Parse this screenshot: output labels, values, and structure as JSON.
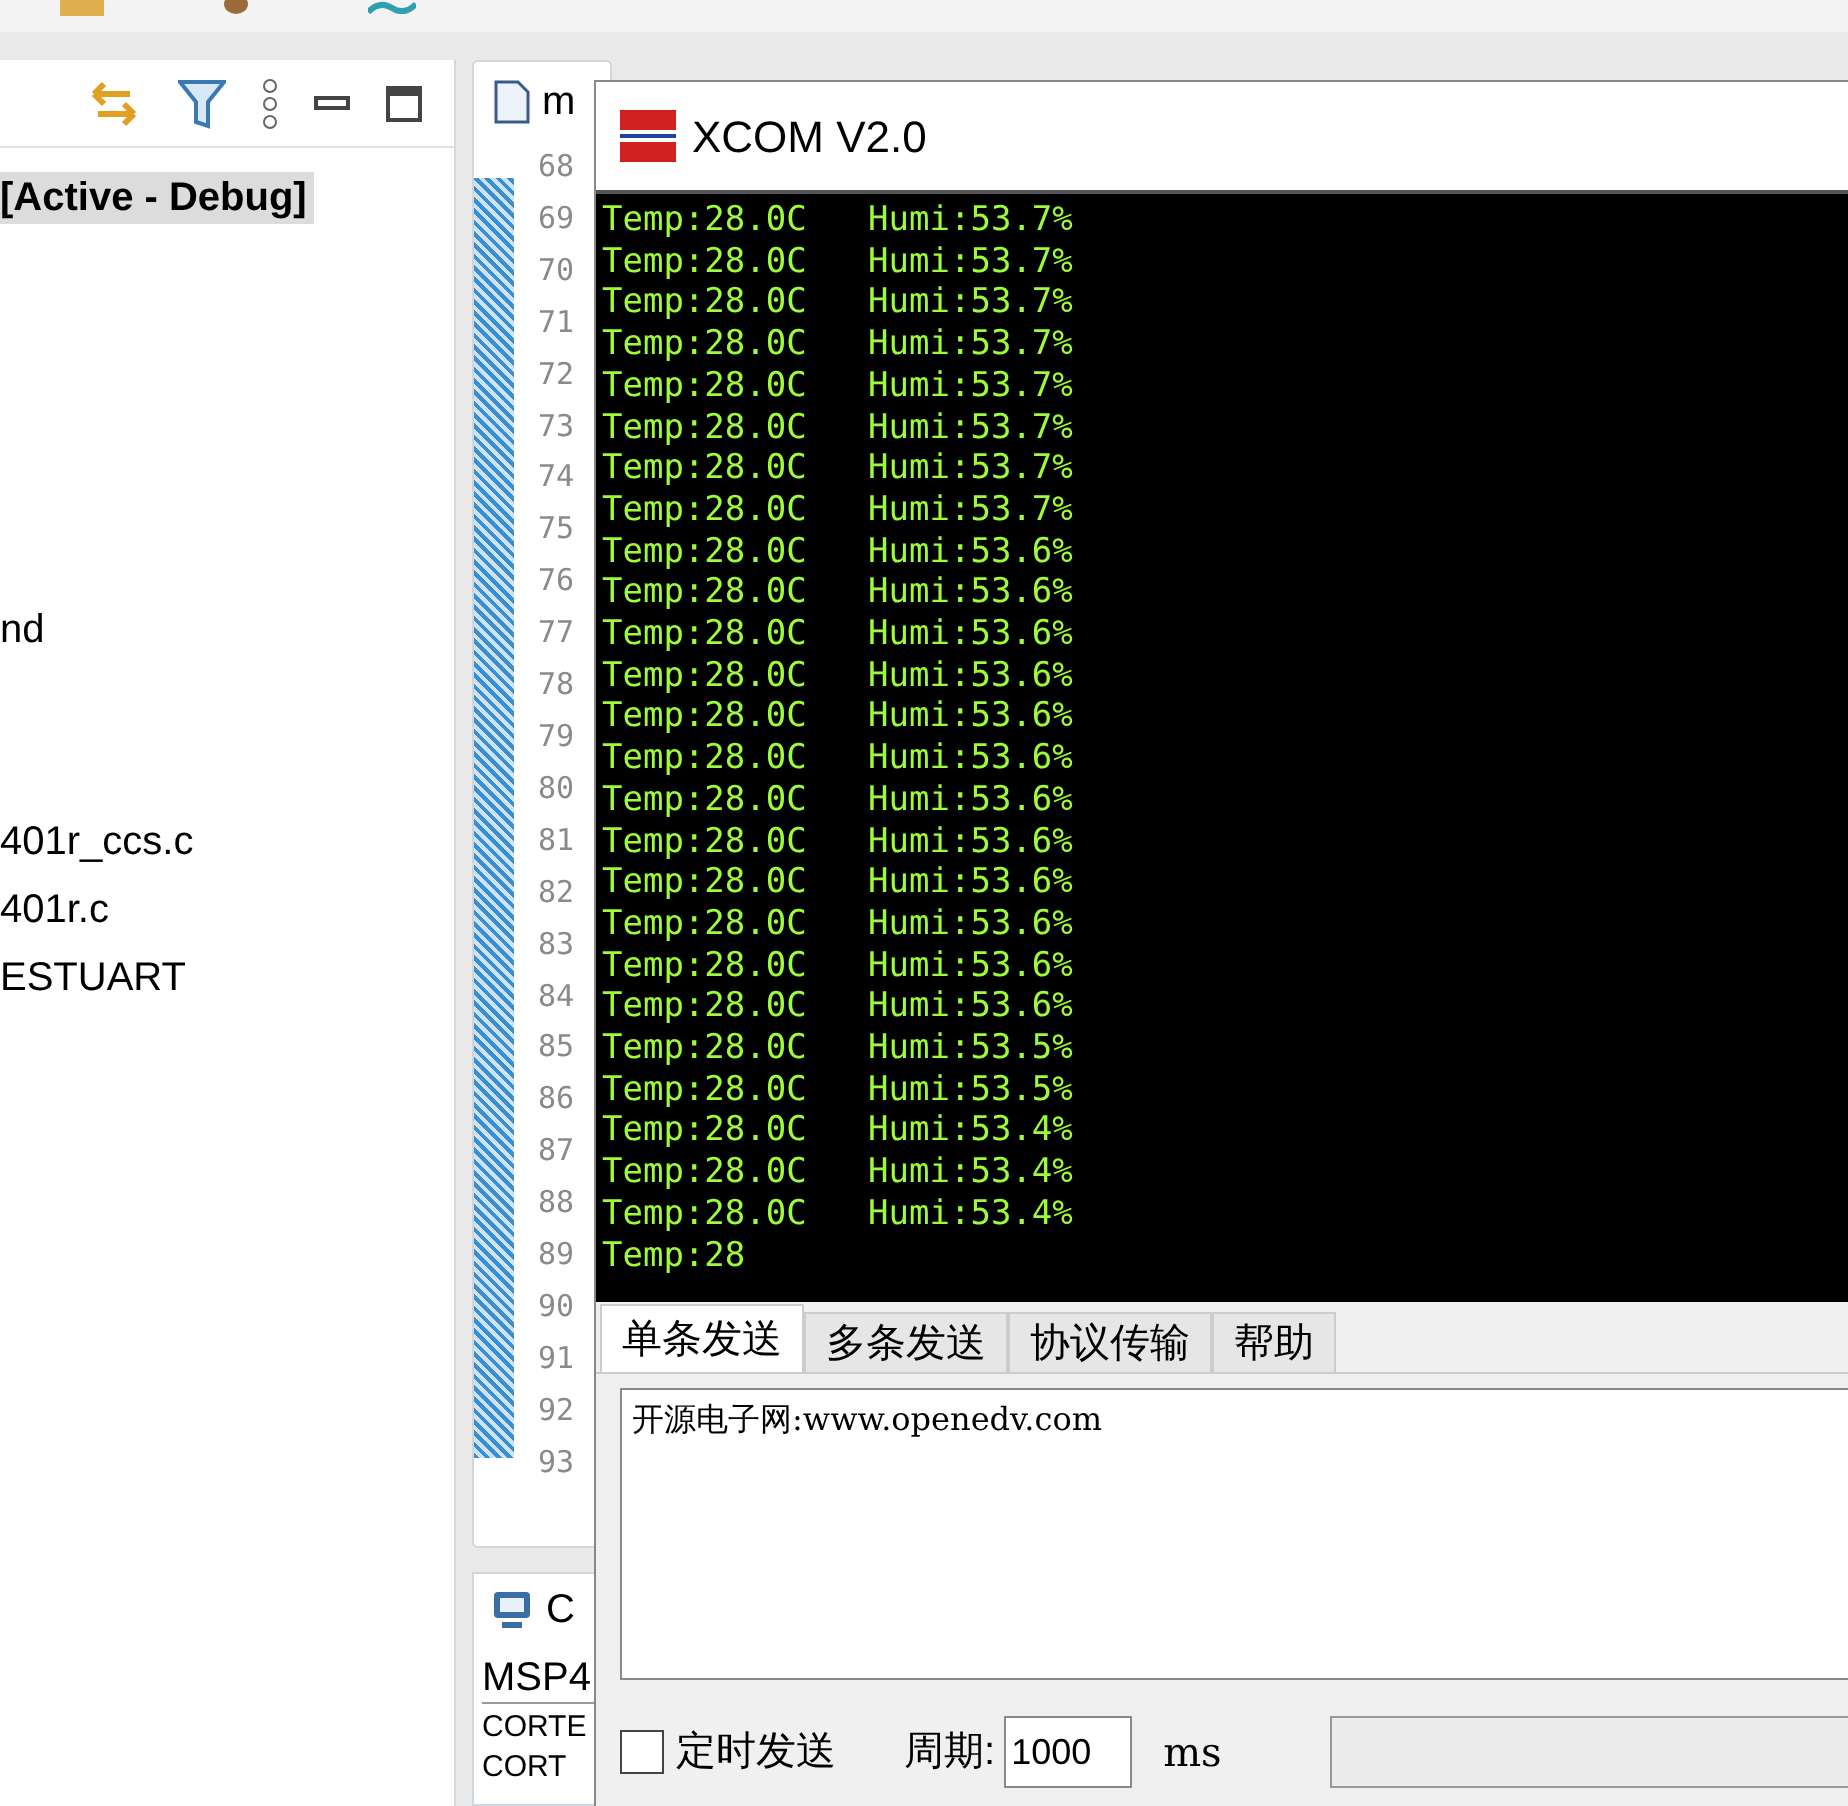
{
  "explorer": {
    "items": [
      {
        "label": "[Active - Debug]",
        "selected": true
      },
      {
        "label": "nd",
        "selected": false
      },
      {
        "label": "401r_ccs.c",
        "selected": false
      },
      {
        "label": "401r.c",
        "selected": false
      },
      {
        "label": "ESTUART",
        "selected": false
      }
    ]
  },
  "editor": {
    "tab": "m",
    "line_numbers": [
      "68",
      "69",
      "70",
      "71",
      "72",
      "73",
      "74",
      "75",
      "76",
      "77",
      "78",
      "79",
      "80",
      "81",
      "82",
      "83",
      "84",
      "85",
      "86",
      "87",
      "88",
      "89",
      "90",
      "91",
      "92",
      "93"
    ]
  },
  "console": {
    "tab": "C",
    "label": "MSP4",
    "lines": [
      "CORTE",
      "CORT"
    ]
  },
  "xcom": {
    "title": "XCOM V2.0",
    "terminal_lines": [
      "Temp:28.0C   Humi:53.7%",
      "Temp:28.0C   Humi:53.7%",
      "Temp:28.0C   Humi:53.7%",
      "Temp:28.0C   Humi:53.7%",
      "Temp:28.0C   Humi:53.7%",
      "Temp:28.0C   Humi:53.7%",
      "Temp:28.0C   Humi:53.7%",
      "Temp:28.0C   Humi:53.7%",
      "Temp:28.0C   Humi:53.6%",
      "Temp:28.0C   Humi:53.6%",
      "Temp:28.0C   Humi:53.6%",
      "Temp:28.0C   Humi:53.6%",
      "Temp:28.0C   Humi:53.6%",
      "Temp:28.0C   Humi:53.6%",
      "Temp:28.0C   Humi:53.6%",
      "Temp:28.0C   Humi:53.6%",
      "Temp:28.0C   Humi:53.6%",
      "Temp:28.0C   Humi:53.6%",
      "Temp:28.0C   Humi:53.6%",
      "Temp:28.0C   Humi:53.6%",
      "Temp:28.0C   Humi:53.5%",
      "Temp:28.0C   Humi:53.5%",
      "Temp:28.0C   Humi:53.4%",
      "Temp:28.0C   Humi:53.4%",
      "Temp:28.0C   Humi:53.4%",
      "Temp:28"
    ],
    "tabs": [
      {
        "label": "单条发送",
        "selected": true
      },
      {
        "label": "多条发送",
        "selected": false
      },
      {
        "label": "协议传输",
        "selected": false
      },
      {
        "label": "帮助",
        "selected": false
      }
    ],
    "send_text": "开源电子网:www.openedv.com",
    "timed_send": {
      "label": "定时发送",
      "checked": false
    },
    "period": {
      "label": "周期:",
      "value": "1000",
      "unit": "ms"
    }
  }
}
